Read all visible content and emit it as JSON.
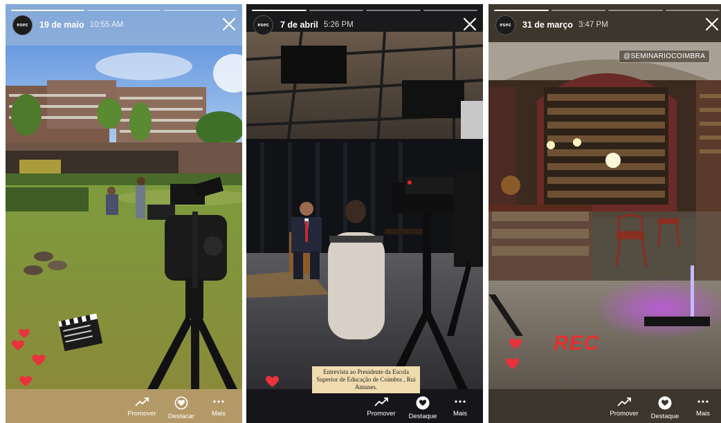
{
  "stories": [
    {
      "account_logo": "esec",
      "date": "19 de maio",
      "time": "10:55 AM",
      "progress": {
        "segments": 3,
        "completed": 1
      },
      "actions": [
        {
          "icon": "trending-up-icon",
          "label": "Promover"
        },
        {
          "icon": "heart-circle-icon",
          "label": "Destacar"
        },
        {
          "icon": "more-icon",
          "label": "Mais"
        }
      ]
    },
    {
      "account_logo": "esec",
      "date": "7 de abril",
      "time": "5:26 PM",
      "progress": {
        "segments": 4,
        "completed": 1
      },
      "caption": "Entrevista ao Presidente da Escola Superior de Educação de Coimbra , Rui Antunes.",
      "actions": [
        {
          "icon": "trending-up-icon",
          "label": "Promover"
        },
        {
          "icon": "heart-circle-filled-icon",
          "label": "Destaque"
        },
        {
          "icon": "more-icon",
          "label": "Mais"
        }
      ]
    },
    {
      "account_logo": "esec",
      "date": "31 de março",
      "time": "3:47 PM",
      "progress": {
        "segments": 4,
        "completed": 1
      },
      "tag": "@SEMINARIOCOIMBRA",
      "sticker": "REC",
      "actions": [
        {
          "icon": "trending-up-icon",
          "label": "Promover"
        },
        {
          "icon": "heart-circle-filled-icon",
          "label": "Destaque"
        },
        {
          "icon": "more-icon",
          "label": "Mais"
        }
      ]
    }
  ],
  "colors": {
    "story1_bar": "#b49968",
    "story2_bar": "#16161a",
    "story3_bar": "#3d362d",
    "heart": "#e8323c",
    "rec": "#e4302f",
    "caption_bg": "#f1dcaf"
  }
}
